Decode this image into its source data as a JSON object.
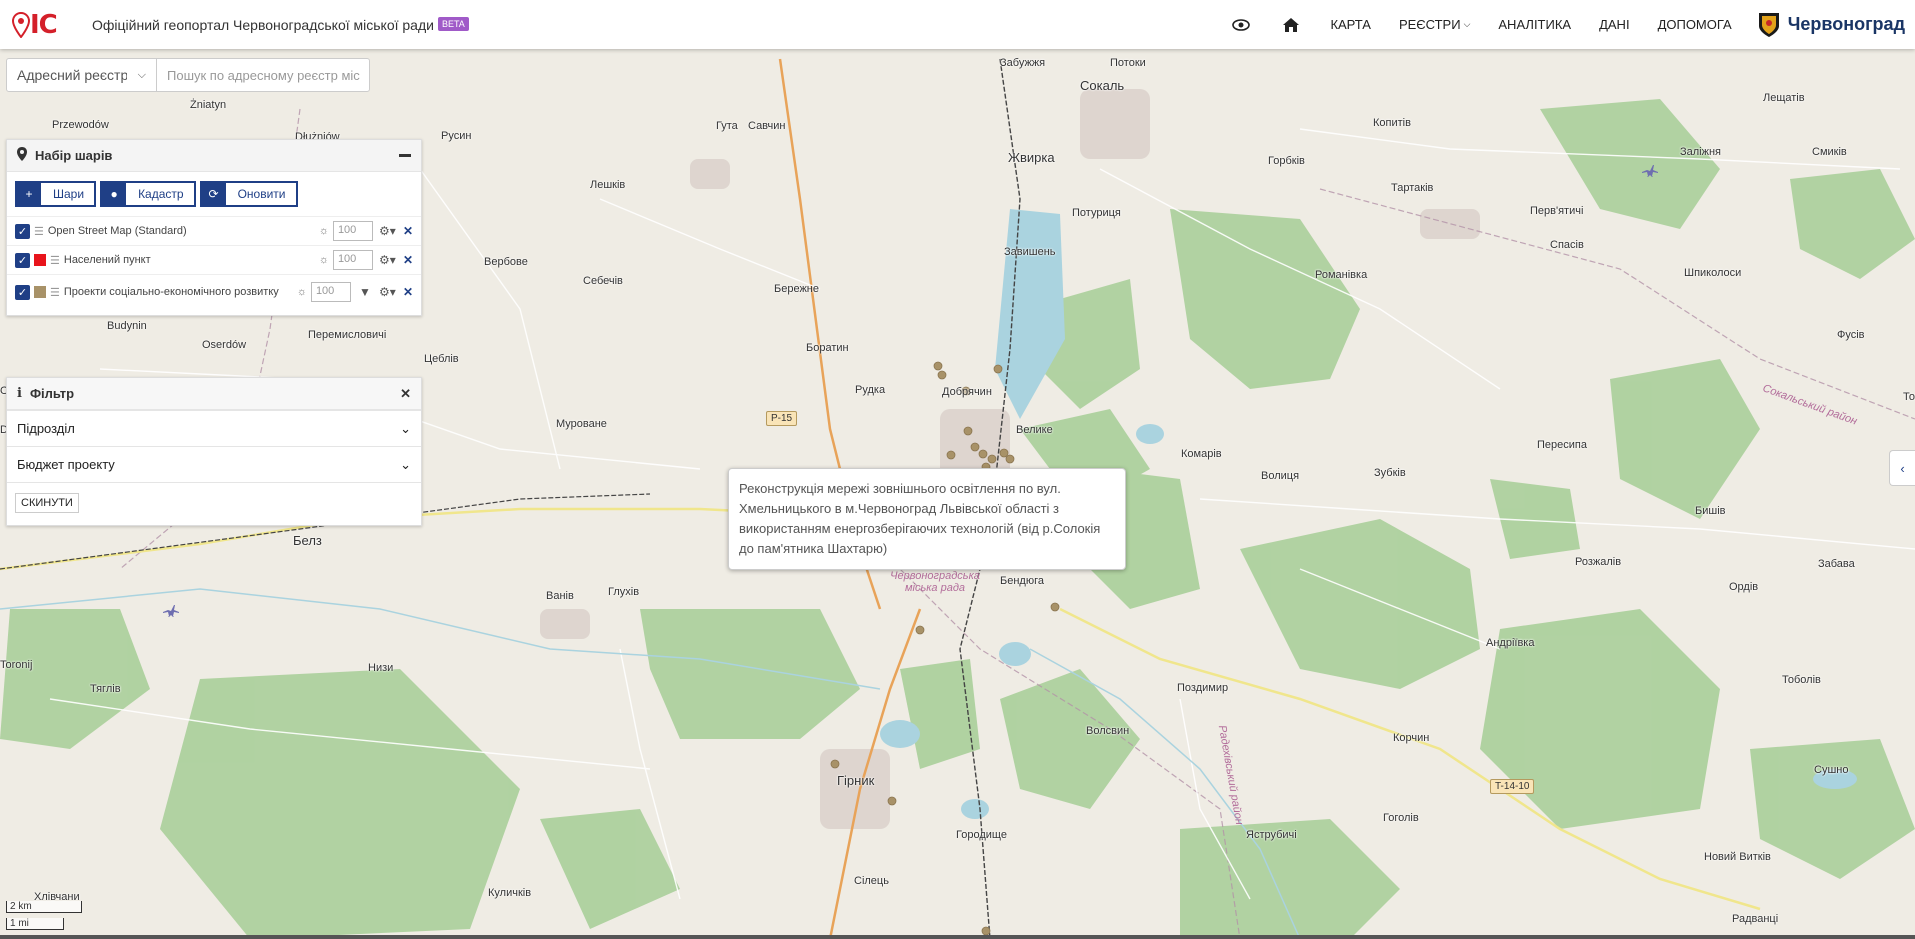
{
  "header": {
    "logo_text": "IC",
    "title": "Офіційний геопортал Червоноградської міської ради",
    "beta": "BETA",
    "nav": [
      "КАРТА",
      "РЕЄСТРИ",
      "АНАЛІТИКА",
      "ДАНІ",
      "ДОПОМОГА"
    ],
    "city": "Червоноград"
  },
  "search": {
    "select_value": "Адресний реєстр",
    "placeholder": "Пошук по адресному реєстр міс"
  },
  "layers_panel": {
    "title": "Набір шарів",
    "buttons": [
      "Шари",
      "Кадастр",
      "Оновити"
    ],
    "layers": [
      {
        "name": "Open Street Map (Standard)",
        "opacity": "100",
        "swatch": ""
      },
      {
        "name": "Населений пункт",
        "opacity": "100",
        "swatch": "#e8141b"
      },
      {
        "name": "Проекти соціально-економічного розвитку",
        "opacity": "100",
        "swatch": "#a89268"
      }
    ]
  },
  "filter_panel": {
    "title": "Фільтр",
    "rows": [
      "Підрозділ",
      "Бюджет проекту"
    ],
    "reset": "СКИНУТИ"
  },
  "tooltip": {
    "text": "Реконструкція мережі зовнішнього освітлення по вул. Хмельницького в м.Червоноград Львівської області з використанням енергозберігаючих технологій (від р.Солокія до пам'ятника Шахтарю)"
  },
  "map": {
    "places": [
      {
        "name": "Сокаль",
        "big": true
      },
      {
        "name": "Жвирка",
        "big": true
      },
      {
        "name": "Гірник",
        "big": true
      },
      {
        "name": "Белз",
        "big": true
      },
      {
        "name": "Забужжя"
      },
      {
        "name": "Потоки"
      },
      {
        "name": "Гута"
      },
      {
        "name": "Савчин"
      },
      {
        "name": "Лешків"
      },
      {
        "name": "Русин"
      },
      {
        "name": "Żniatyn"
      },
      {
        "name": "Przewodów"
      },
      {
        "name": "Dłużniów"
      },
      {
        "name": "Вербове"
      },
      {
        "name": "Себечів"
      },
      {
        "name": "Бережне"
      },
      {
        "name": "Потуриця"
      },
      {
        "name": "Завишень"
      },
      {
        "name": "Копитів"
      },
      {
        "name": "Горбків"
      },
      {
        "name": "Тартаків"
      },
      {
        "name": "Лещатів"
      },
      {
        "name": "Заліжня"
      },
      {
        "name": "Смиків"
      },
      {
        "name": "Перв'ятичі"
      },
      {
        "name": "Спасів"
      },
      {
        "name": "Романівка"
      },
      {
        "name": "Шпиколоси"
      },
      {
        "name": "Фусів"
      },
      {
        "name": "Budynin"
      },
      {
        "name": "Oserdów"
      },
      {
        "name": "Перемисловичі"
      },
      {
        "name": "Цеблів"
      },
      {
        "name": "Боратин"
      },
      {
        "name": "Рудка"
      },
      {
        "name": "Добрячин"
      },
      {
        "name": "Велике"
      },
      {
        "name": "Мурованe"
      },
      {
        "name": "Комарів"
      },
      {
        "name": "Волиця"
      },
      {
        "name": "Зубків"
      },
      {
        "name": "Пересипа"
      },
      {
        "name": "Бишів"
      },
      {
        "name": "Розжалів"
      },
      {
        "name": "Забава"
      },
      {
        "name": "Ордів"
      },
      {
        "name": "Ванів"
      },
      {
        "name": "Глухів"
      },
      {
        "name": "Бендюга"
      },
      {
        "name": "Андріївка"
      },
      {
        "name": "Тяглів"
      },
      {
        "name": "Низи"
      },
      {
        "name": "Поздимир"
      },
      {
        "name": "Тоболів"
      },
      {
        "name": "Волсвин"
      },
      {
        "name": "Корчин"
      },
      {
        "name": "Сушно"
      },
      {
        "name": "Гоголів"
      },
      {
        "name": "Городище"
      },
      {
        "name": "Яструбичі"
      },
      {
        "name": "Новий Витків"
      },
      {
        "name": "Куличків"
      },
      {
        "name": "Сілець"
      },
      {
        "name": "Радванці"
      },
      {
        "name": "Хлівчани"
      },
      {
        "name": "Toronij"
      },
      {
        "name": "Ос"
      },
      {
        "name": "Dro"
      },
      {
        "name": "То"
      }
    ],
    "road_badges": [
      "P-15",
      "T-14-10"
    ],
    "districts": [
      "Сокальський район",
      "Червоноградська міська рада",
      "Радехівський район"
    ],
    "scale": [
      "2 km",
      "1 mi"
    ]
  }
}
